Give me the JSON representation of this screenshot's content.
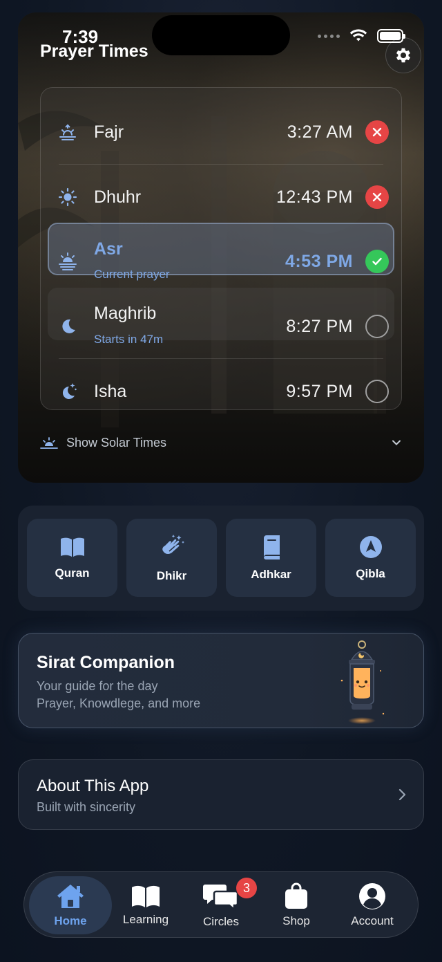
{
  "status_bar": {
    "time": "7:39"
  },
  "header": {
    "title": "Prayer Times",
    "settings_icon": "gear-icon"
  },
  "prayers": [
    {
      "name": "Fajr",
      "time": "3:27 AM",
      "status": "missed",
      "icon": "sunrise-icon"
    },
    {
      "name": "Dhuhr",
      "time": "12:43 PM",
      "status": "missed",
      "icon": "sun-icon"
    },
    {
      "name": "Asr",
      "time": "4:53 PM",
      "status": "done",
      "subtitle": "Current prayer",
      "icon": "sun-haze-icon"
    },
    {
      "name": "Maghrib",
      "time": "8:27 PM",
      "status": "open",
      "subtitle": "Starts in 47m",
      "icon": "moon-icon"
    },
    {
      "name": "Isha",
      "time": "9:57 PM",
      "status": "open",
      "icon": "moon-stars-icon"
    }
  ],
  "solar": {
    "label": "Show Solar Times"
  },
  "actions": [
    {
      "label": "Quran",
      "icon": "book-open-icon"
    },
    {
      "label": "Dhikr",
      "icon": "hands-clap-icon"
    },
    {
      "label": "Adhkar",
      "icon": "book-icon"
    },
    {
      "label": "Qibla",
      "icon": "compass-arrow-icon"
    }
  ],
  "companion": {
    "title": "Sirat Companion",
    "line1": "Your guide for the day",
    "line2": "Prayer, Knowdlege, and more"
  },
  "about": {
    "title": "About This App",
    "subtitle": "Built with sincerity"
  },
  "tabs": [
    {
      "label": "Home",
      "icon": "home-icon",
      "active": true
    },
    {
      "label": "Learning",
      "icon": "book-open-icon"
    },
    {
      "label": "Circles",
      "icon": "chat-bubbles-icon",
      "badge": "3"
    },
    {
      "label": "Shop",
      "icon": "shopping-bag-icon"
    },
    {
      "label": "Account",
      "icon": "user-circle-icon"
    }
  ],
  "colors": {
    "accent": "#6ea3ee",
    "missed": "#e64545",
    "done": "#35c75a",
    "background": "#111827"
  }
}
